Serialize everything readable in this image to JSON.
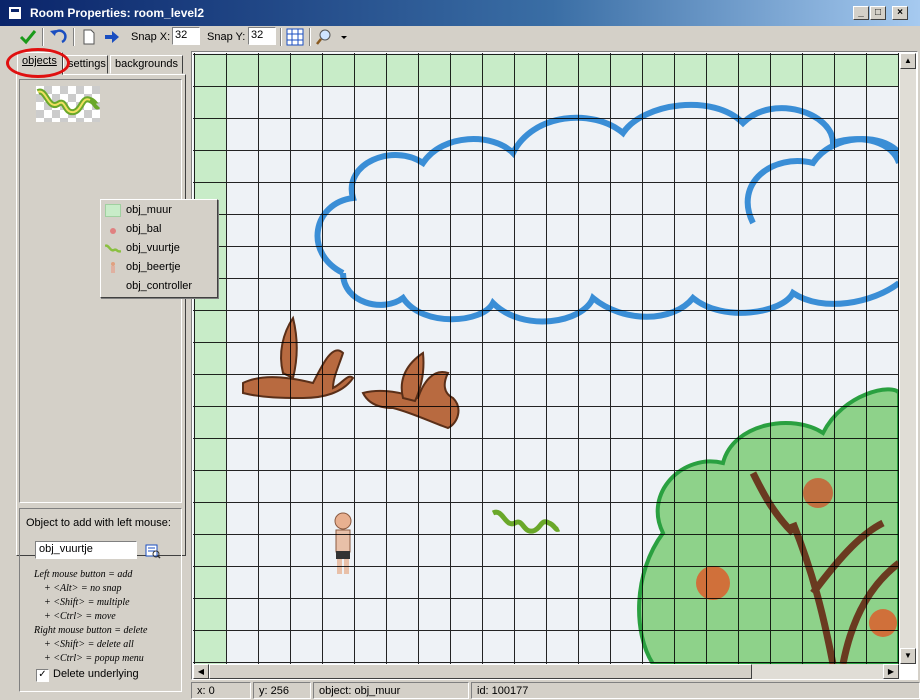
{
  "window": {
    "title": "Room Properties: room_level2"
  },
  "toolbar": {
    "snap_x_label": "Snap X:",
    "snap_x_value": "32",
    "snap_y_label": "Snap Y:",
    "snap_y_value": "32"
  },
  "tabs": [
    {
      "label": "objects",
      "active": true
    },
    {
      "label": "settings",
      "active": false
    },
    {
      "label": "backgrounds",
      "active": false
    }
  ],
  "popup_menu": {
    "items": [
      {
        "label": "obj_muur",
        "icon": "wall-tile-icon"
      },
      {
        "label": "obj_bal",
        "icon": "ball-icon"
      },
      {
        "label": "obj_vuurtje",
        "icon": "flame-snake-icon"
      },
      {
        "label": "obj_beertje",
        "icon": "bear-icon"
      },
      {
        "label": "obj_controller",
        "icon": "none"
      }
    ]
  },
  "object_panel": {
    "label": "Object to add with left mouse:",
    "current_object": "obj_vuurtje",
    "hints": [
      "Left mouse button = add",
      "+ <Alt> = no snap",
      "+ <Shift> = multiple",
      "+ <Ctrl> = move",
      "Right mouse button = delete",
      "+ <Shift> = delete all",
      "+ <Ctrl> = popup menu"
    ],
    "delete_underlying_label": "Delete underlying",
    "delete_underlying_checked": true
  },
  "status": {
    "x": "x: 0",
    "y": "y: 256",
    "object": "object: obj_muur",
    "id": "id: 100177"
  },
  "colors": {
    "title_bar": "#0a246a",
    "wall_tile": "#c8ecc8",
    "cloud": "#3a8ed6",
    "tree_green": "#2aa040",
    "bird": "#b86a40",
    "highlight_circle": "#e01010"
  }
}
